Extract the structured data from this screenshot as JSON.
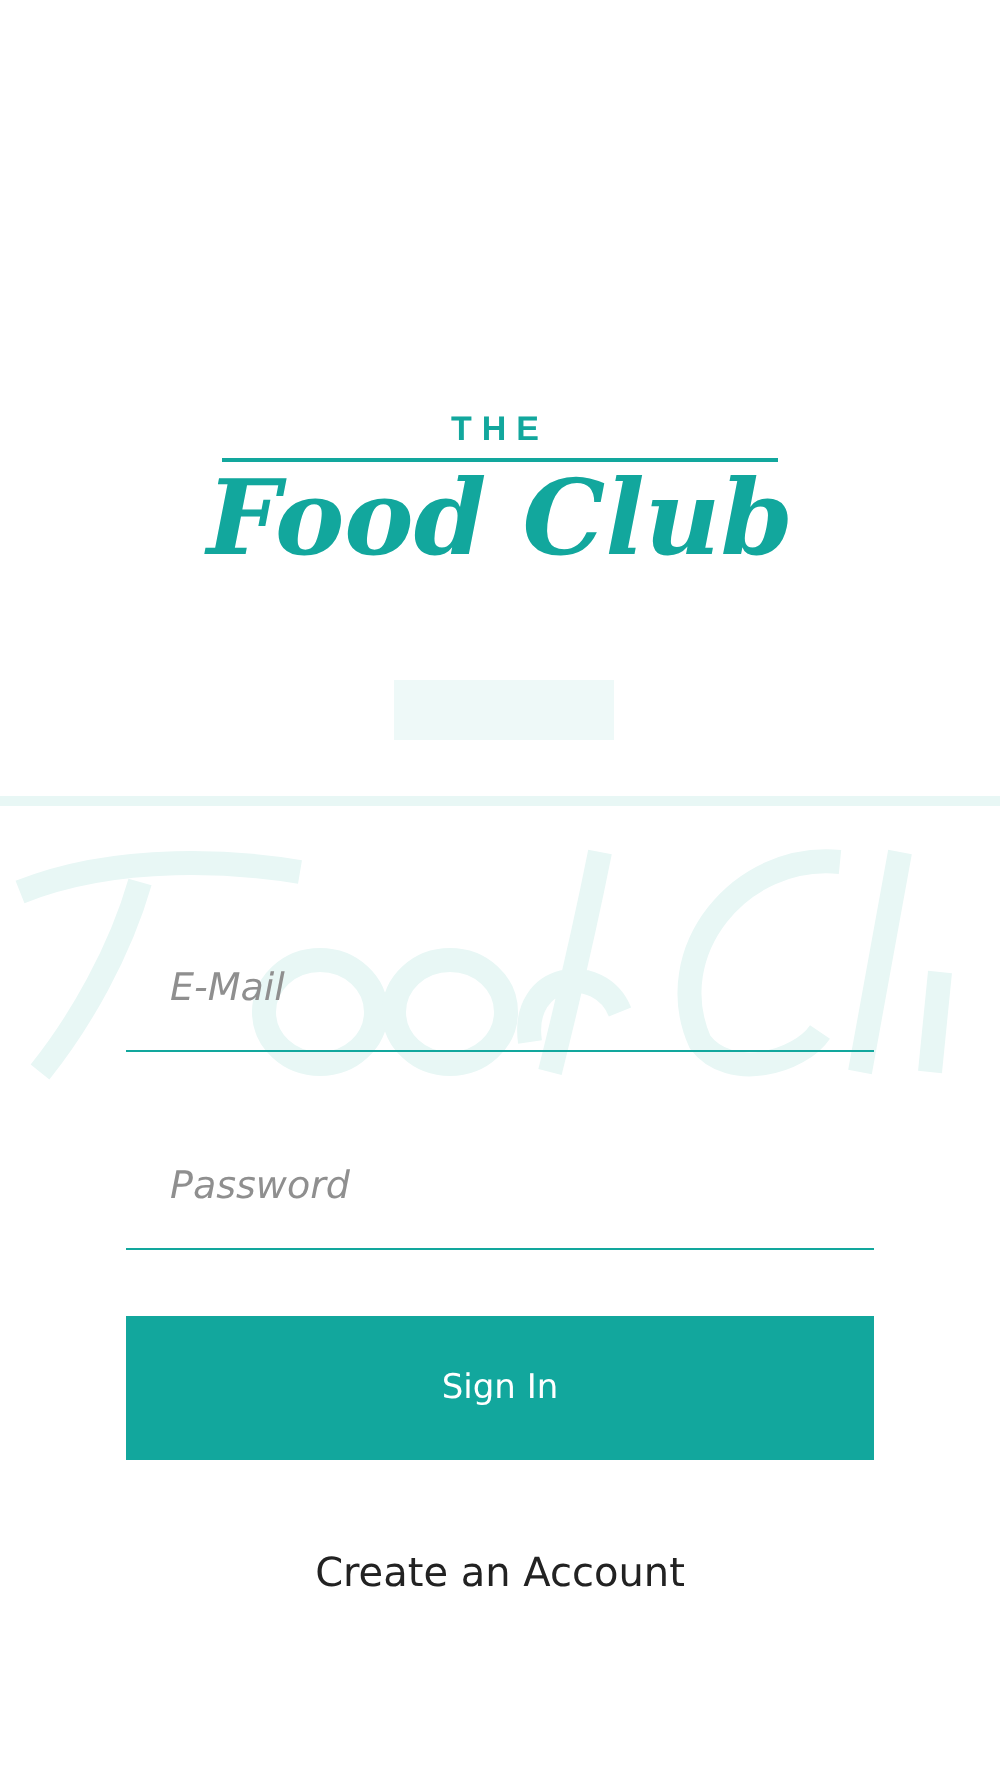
{
  "logo": {
    "top": "THE",
    "name": "Food Club"
  },
  "email": {
    "placeholder": "E-Mail"
  },
  "password": {
    "placeholder": "Password"
  },
  "sign_in": {
    "label": "Sign In"
  },
  "create_account": {
    "label": "Create an Account"
  }
}
